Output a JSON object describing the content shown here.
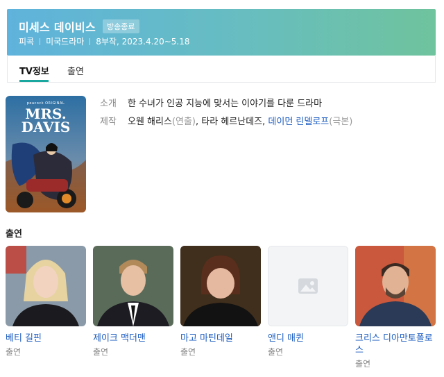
{
  "header": {
    "title": "미세스 데이비스",
    "badge": "방송종료",
    "genre": "피콕",
    "category": "미국드라마",
    "episodes_dates": "8부작, 2023.4.20~5.18"
  },
  "tabs": [
    {
      "label": "TV정보",
      "active": true
    },
    {
      "label": "출연",
      "active": false
    }
  ],
  "poster": {
    "brand": "peacock ORIGINAL",
    "line1": "MRS.",
    "line2": "DAVIS"
  },
  "info": {
    "summary_label": "소개",
    "summary_text": "한 수녀가 인공 지능에 맞서는 이야기를 다룬 드라마",
    "production_label": "제작",
    "credits": [
      {
        "name": "오웬 해리스",
        "role": "(연출)",
        "link": false
      },
      {
        "name": "타라 헤르난데즈",
        "role": "",
        "link": false
      },
      {
        "name": "데이먼 린델로프",
        "role": "(극본)",
        "link": true
      }
    ],
    "comma": ", "
  },
  "cast_section": {
    "title": "출연",
    "members": [
      {
        "name": "베티 길핀",
        "role": "출연"
      },
      {
        "name": "제이크 맥더맨",
        "role": "출연"
      },
      {
        "name": "마고 마틴데일",
        "role": "출연"
      },
      {
        "name": "앤디 매퀸",
        "role": "출연"
      },
      {
        "name": "크리스 디아만토폴로스",
        "role": "출연"
      }
    ]
  },
  "colors": {
    "header_gradient_start": "#5fb3dc",
    "header_gradient_end": "#6fc39d",
    "tab_active_underline": "#19a7a0",
    "link": "#1a5bbf"
  }
}
